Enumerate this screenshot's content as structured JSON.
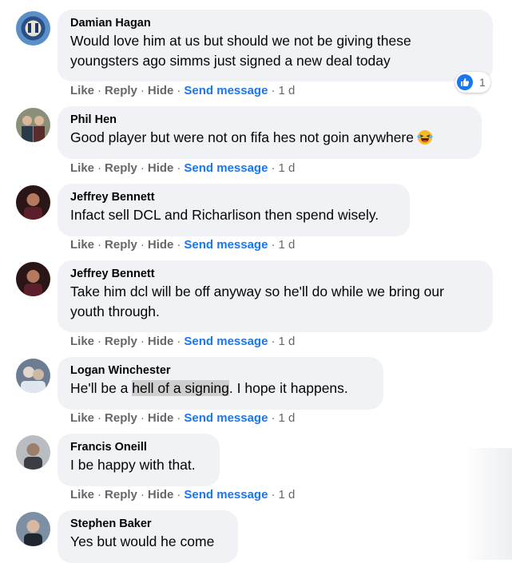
{
  "actions": {
    "like": "Like",
    "reply": "Reply",
    "hide": "Hide",
    "send_message": "Send message",
    "dot": "·"
  },
  "comments": [
    {
      "author": "Damian Hagan",
      "text": "Would love him at us but should we not be giving these youngsters ago simms just signed a new deal today",
      "time": "1 d",
      "reaction": {
        "icon": "like-icon",
        "count": "1"
      }
    },
    {
      "author": "Phil Hen",
      "text": "Good player but were not on fifa hes not goin anywhere",
      "emoji": "laughing-tears-emoji",
      "time": "1 d"
    },
    {
      "author": "Jeffrey Bennett",
      "text": "Infact sell DCL and Richarlison then spend wisely.",
      "time": "1 d"
    },
    {
      "author": "Jeffrey Bennett",
      "text": "Take him dcl will be off anyway so he'll do while we bring our youth through.",
      "time": "1 d"
    },
    {
      "author": "Logan Winchester",
      "text_before": "He'll be a ",
      "text_highlight": "hell of a signing",
      "text_after": ". I hope it happens.",
      "time": "1 d"
    },
    {
      "author": "Francis Oneill",
      "text": "I be happy with that.",
      "time": "1 d"
    },
    {
      "author": "Stephen Baker",
      "text": "Yes but would he come"
    }
  ],
  "colors": {
    "bubble": "#f0f2f5",
    "link_blue": "#1877f2",
    "meta_gray": "#65676b",
    "highlight": "#cfcfcf"
  }
}
